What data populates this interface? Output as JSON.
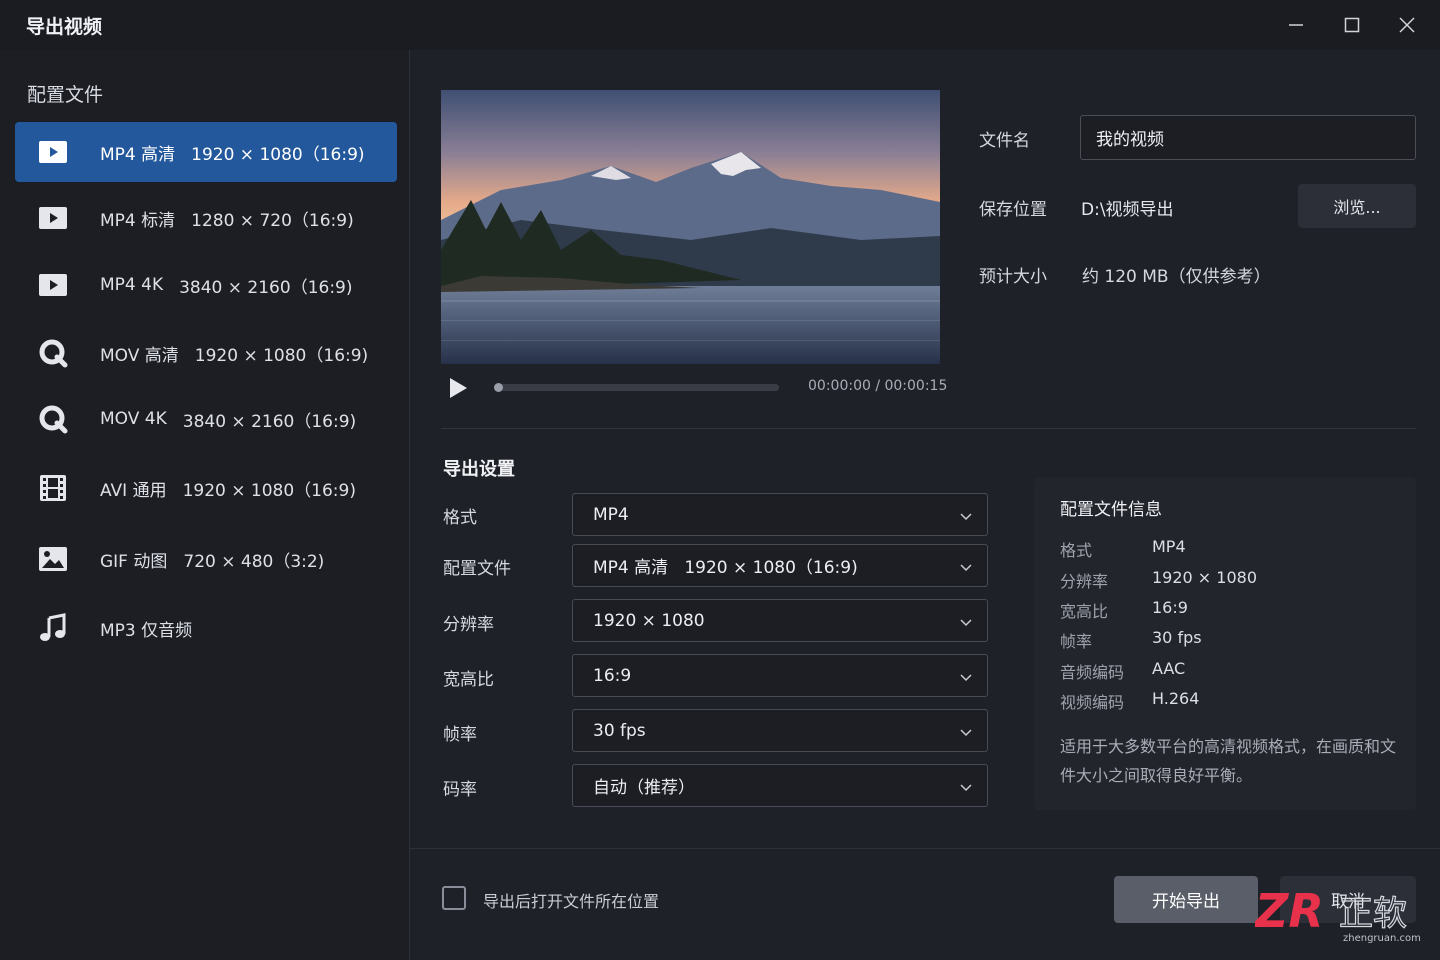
{
  "window": {
    "title": "导出视频",
    "minimize_icon": "minimize-icon",
    "maximize_icon": "maximize-icon",
    "close_icon": "close-icon"
  },
  "sidebar": {
    "heading": "配置文件",
    "profiles": [
      {
        "name": "MP4 高清",
        "spec": "1920 × 1080（16:9)",
        "icon": "play-icon",
        "active": true
      },
      {
        "name": "MP4 标清",
        "spec": "1280 × 720（16:9)",
        "icon": "play-icon",
        "active": false
      },
      {
        "name": "MP4 4K",
        "spec": "3840 × 2160（16:9)",
        "icon": "play-icon",
        "active": false
      },
      {
        "name": "MOV 高清",
        "spec": "1920 × 1080（16:9)",
        "icon": "quicktime-icon",
        "active": false
      },
      {
        "name": "MOV 4K",
        "spec": "3840 × 2160（16:9)",
        "icon": "quicktime-icon",
        "active": false
      },
      {
        "name": "AVI 通用",
        "spec": "1920 × 1080（16:9)",
        "icon": "film-icon",
        "active": false
      },
      {
        "name": "GIF 动图",
        "spec": "720 × 480（3:2)",
        "icon": "image-icon",
        "active": false
      },
      {
        "name": "MP3 仅音频",
        "spec": "",
        "icon": "music-icon",
        "active": false
      }
    ]
  },
  "preview": {
    "current_time": "00:00:00 / 00:00:15",
    "progress": 0.0
  },
  "file": {
    "name_label": "文件名",
    "name_value": "我的视频",
    "location_label": "保存位置",
    "location_value": "D:\\视频导出",
    "browse_label": "浏览...",
    "size_label": "预计大小",
    "size_value": "约 120 MB（仅供参考）"
  },
  "settings": {
    "title": "导出设置",
    "rows": [
      {
        "label": "格式",
        "value": "MP4"
      },
      {
        "label": "配置文件",
        "value": "MP4 高清   1920 × 1080（16:9)"
      },
      {
        "label": "分辨率",
        "value": "1920 × 1080"
      },
      {
        "label": "宽高比",
        "value": "16:9"
      },
      {
        "label": "帧率",
        "value": "30 fps"
      },
      {
        "label": "码率",
        "value": "自动（推荐）"
      }
    ]
  },
  "info": {
    "title": "配置文件信息",
    "rows": [
      {
        "key": "格式",
        "value": "MP4"
      },
      {
        "key": "分辨率",
        "value": "1920 × 1080"
      },
      {
        "key": "宽高比",
        "value": "16:9"
      },
      {
        "key": "帧率",
        "value": "30 fps"
      },
      {
        "key": "音频编码",
        "value": "AAC"
      },
      {
        "key": "视频编码",
        "value": "H.264"
      }
    ],
    "description": "适用于大多数平台的高清视频格式，在画质和文件大小之间取得良好平衡。"
  },
  "footer": {
    "open_folder_label": "导出后打开文件所在位置",
    "open_folder_checked": false,
    "export_label": "开始导出",
    "cancel_label": "取消"
  },
  "watermark": {
    "brand": "ZR",
    "text": "正软",
    "site": "zhengruan.com"
  },
  "colors": {
    "accent": "#24589c",
    "background": "#1f2128",
    "sidebar": "#1c1e24"
  }
}
